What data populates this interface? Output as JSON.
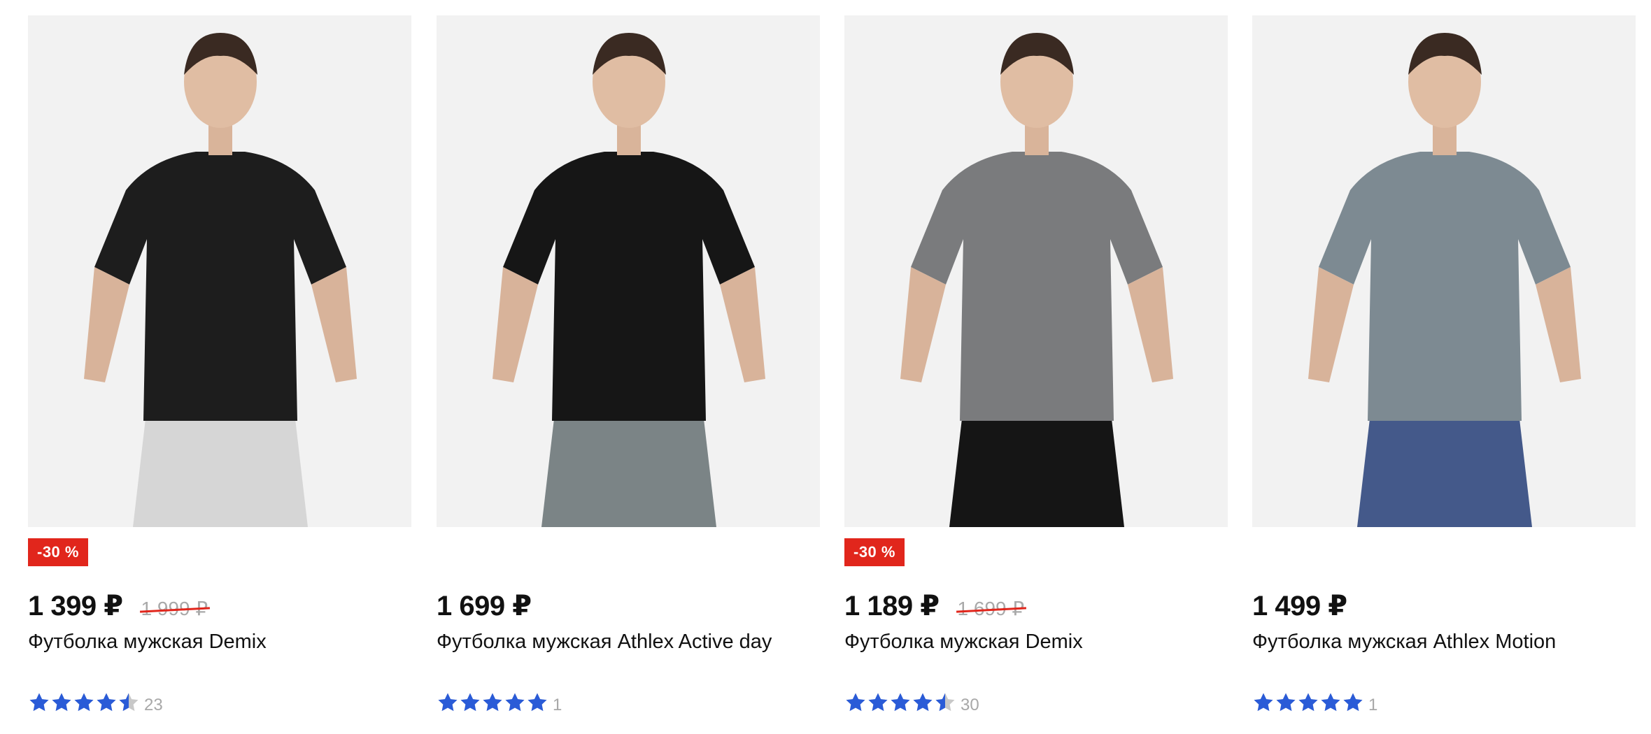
{
  "products": [
    {
      "badge": "-30 %",
      "price": "1 399 ₽",
      "old_price": "1 999 ₽",
      "title": "Футболка мужская Demix",
      "rating": 4.5,
      "reviews": "23",
      "shirt_color": "#1d1d1d",
      "shorts_color": "#d6d6d6"
    },
    {
      "badge": "",
      "price": "1 699 ₽",
      "old_price": "",
      "title": "Футболка мужская Athlex Active day",
      "rating": 5,
      "reviews": "1",
      "shirt_color": "#161616",
      "shorts_color": "#7b8486"
    },
    {
      "badge": "-30 %",
      "price": "1 189 ₽",
      "old_price": "1 699 ₽",
      "title": "Футболка мужская Demix",
      "rating": 4.5,
      "reviews": "30",
      "shirt_color": "#7a7b7d",
      "shorts_color": "#151515"
    },
    {
      "badge": "",
      "price": "1 499 ₽",
      "old_price": "",
      "title": "Футболка мужская Athlex Motion",
      "rating": 5,
      "reviews": "1",
      "shirt_color": "#7d8a92",
      "shorts_color": "#44598a"
    }
  ],
  "colors": {
    "badge_bg": "#e1261c",
    "star": "#2a5bd7",
    "star_empty": "#c8c8c8",
    "photo_bg": "#f2f2f2"
  }
}
